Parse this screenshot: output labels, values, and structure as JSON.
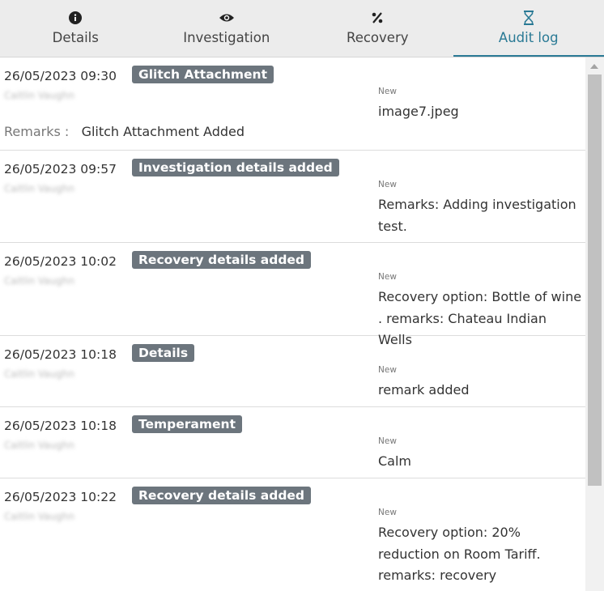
{
  "tabs": [
    {
      "label": "Details",
      "icon": "info-icon",
      "active": false
    },
    {
      "label": "Investigation",
      "icon": "eye-icon",
      "active": false
    },
    {
      "label": "Recovery",
      "icon": "percent-icon",
      "active": false
    },
    {
      "label": "Audit log",
      "icon": "hourglass-icon",
      "active": true
    }
  ],
  "colors": {
    "accent": "#2a7a95",
    "badge": "#6c757d",
    "tab_bg": "#ececec"
  },
  "entries": [
    {
      "timestamp": "26/05/2023 09:30",
      "action": "Glitch Attachment",
      "user": "Caitlin Vaughn",
      "new_label": "New",
      "new_value": "image7.jpeg",
      "remarks_label": "Remarks :",
      "remarks_text": "Glitch Attachment Added"
    },
    {
      "timestamp": "26/05/2023 09:57",
      "action": "Investigation details added",
      "user": "Caitlin Vaughn",
      "new_label": "New",
      "new_value": "Remarks: Adding investigation test."
    },
    {
      "timestamp": "26/05/2023 10:02",
      "action": "Recovery details added",
      "user": "Caitlin Vaughn",
      "new_label": "New",
      "new_value": "Recovery option: Bottle of wine . remarks: Chateau Indian Wells"
    },
    {
      "timestamp": "26/05/2023 10:18",
      "action": "Details",
      "user": "Caitlin Vaughn",
      "new_label": "New",
      "new_value": "remark added"
    },
    {
      "timestamp": "26/05/2023 10:18",
      "action": "Temperament",
      "user": "Caitlin Vaughn",
      "new_label": "New",
      "new_value": "Calm"
    },
    {
      "timestamp": "26/05/2023 10:22",
      "action": "Recovery details added",
      "user": "Caitlin Vaughn",
      "new_label": "New",
      "new_value": "Recovery option: 20% reduction on Room Tariff. remarks: recovery"
    }
  ]
}
